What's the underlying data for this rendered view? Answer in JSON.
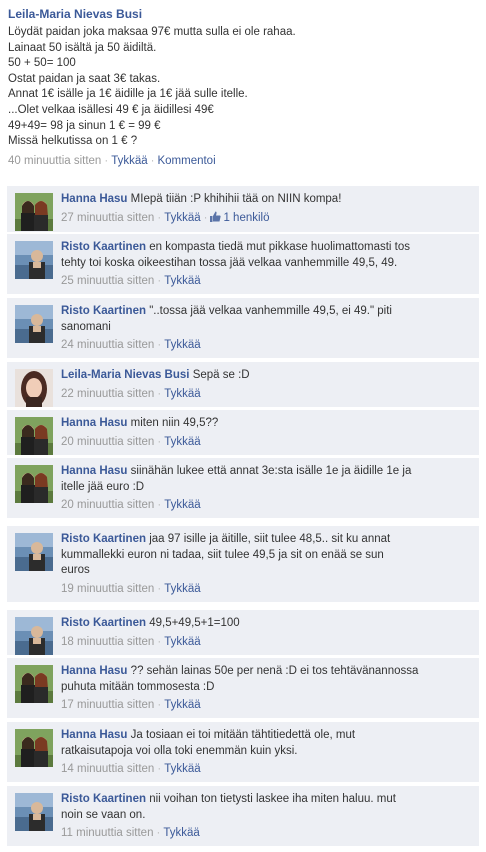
{
  "post": {
    "author": "Leila-Maria Nievas Busi",
    "lines": [
      "Löydät paidan joka maksaa 97€ mutta sulla ei ole rahaa.",
      "Lainaat 50 isältä ja 50 äidiltä.",
      "50 + 50= 100",
      "Ostat paidan ja saat 3€ takas.",
      "Annat 1€ isälle ja 1€ äidille ja 1€ jää sulle itelle.",
      "...Olet velkaa isällesi 49 € ja äidillesi 49€",
      "49+49= 98 ja sinun 1 € = 99 €",
      "Missä helkutissa on 1 € ?"
    ],
    "time": "40 minuuttia sitten",
    "like": "Tykkää",
    "comment": "Kommentoi"
  },
  "comments": [
    {
      "author": "Hanna Hasu",
      "avatar": "couple",
      "lines": [
        "MIepä tiiän :P khihihii tää on NIIN kompa!"
      ],
      "time": "27 minuuttia sitten",
      "like": "Tykkää",
      "likes": "1 henkilö"
    },
    {
      "author": "Risto Kaartinen",
      "avatar": "risto",
      "lines": [
        "en kompasta tiedä mut pikkase huolimattomasti tos",
        "tehty toi koska oikeestihan tossa jää velkaa vanhemmille 49,5, 49."
      ],
      "time": "25 minuuttia sitten",
      "like": "Tykkää"
    },
    {
      "author": "Risto Kaartinen",
      "avatar": "risto",
      "lines": [
        "\"..tossa jää velkaa vanhemmille 49,5, ei 49.\" piti",
        "sanomani"
      ],
      "time": "24 minuuttia sitten",
      "like": "Tykkää"
    },
    {
      "author": "Leila-Maria Nievas Busi",
      "avatar": "leila",
      "lines": [
        "Sepä se :D"
      ],
      "time": "22 minuuttia sitten",
      "like": "Tykkää"
    },
    {
      "author": "Hanna Hasu",
      "avatar": "couple",
      "lines": [
        "miten niin 49,5??"
      ],
      "time": "20 minuuttia sitten",
      "like": "Tykkää"
    },
    {
      "author": "Hanna Hasu",
      "avatar": "couple",
      "lines": [
        "siinähän lukee että annat 3e:sta isälle 1e ja äidille 1e ja",
        "itelle jää euro :D"
      ],
      "time": "20 minuuttia sitten",
      "like": "Tykkää"
    },
    {
      "author": "Risto Kaartinen",
      "avatar": "risto",
      "lines": [
        "jaa 97 isille ja äitille, siit tulee 48,5.. sit ku annat",
        "kummallekki euron ni tadaa, siit tulee 49,5 ja sit on enää se sun",
        "euros"
      ],
      "time": "19 minuuttia sitten",
      "like": "Tykkää"
    },
    {
      "author": "Risto Kaartinen",
      "avatar": "risto",
      "lines": [
        "49,5+49,5+1=100"
      ],
      "time": "18 minuuttia sitten",
      "like": "Tykkää"
    },
    {
      "author": "Hanna Hasu",
      "avatar": "couple",
      "lines": [
        "?? sehän lainas 50e per nenä :D ei tos tehtävänannossa",
        "puhuta mitään tommosesta :D"
      ],
      "time": "17 minuuttia sitten",
      "like": "Tykkää"
    },
    {
      "author": "Hanna Hasu",
      "avatar": "couple",
      "lines": [
        "Ja tosiaan ei toi mitään tähtitiedettä ole, mut",
        "ratkaisutapoja voi olla toki enemmän kuin yksi."
      ],
      "time": "14 minuuttia sitten",
      "like": "Tykkää"
    },
    {
      "author": "Risto Kaartinen",
      "avatar": "risto",
      "lines": [
        "nii voihan ton tietysti laskee iha miten haluu. mut",
        "noin se vaan on."
      ],
      "time": "11 minuuttia sitten",
      "like": "Tykkää"
    }
  ],
  "colors": {
    "link": "#3b5998",
    "comment_bg": "#edeff4",
    "meta": "#999999"
  }
}
